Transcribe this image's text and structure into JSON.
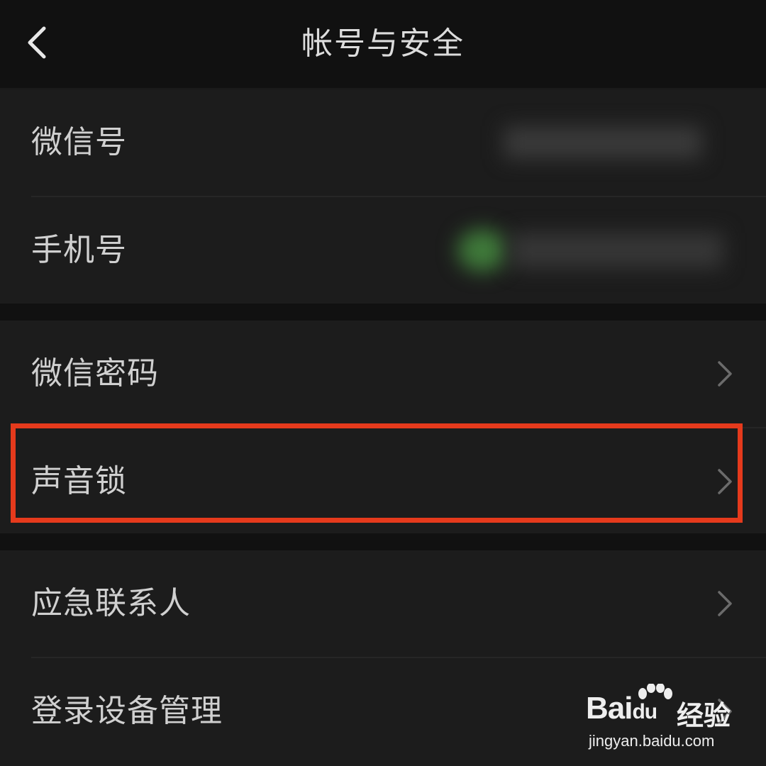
{
  "header": {
    "title": "帐号与安全"
  },
  "groups": [
    {
      "rows": [
        {
          "label": "微信号",
          "value_hidden": true
        },
        {
          "label": "手机号",
          "value_hidden": true
        }
      ]
    },
    {
      "rows": [
        {
          "label": "微信密码"
        },
        {
          "label": "声音锁",
          "highlighted": true
        }
      ]
    },
    {
      "rows": [
        {
          "label": "应急联系人"
        },
        {
          "label": "登录设备管理"
        }
      ]
    }
  ],
  "watermark": {
    "brand": "Bai",
    "brand_suffix": "du",
    "product": "经验",
    "url": "jingyan.baidu.com"
  },
  "colors": {
    "background": "#111111",
    "row_background": "#1c1c1c",
    "text": "#d0d0d0",
    "highlight": "#e53a1c"
  },
  "icons": {
    "back": "chevron-left-icon",
    "row_arrow": "chevron-right-icon",
    "watermark": "paw-icon"
  }
}
